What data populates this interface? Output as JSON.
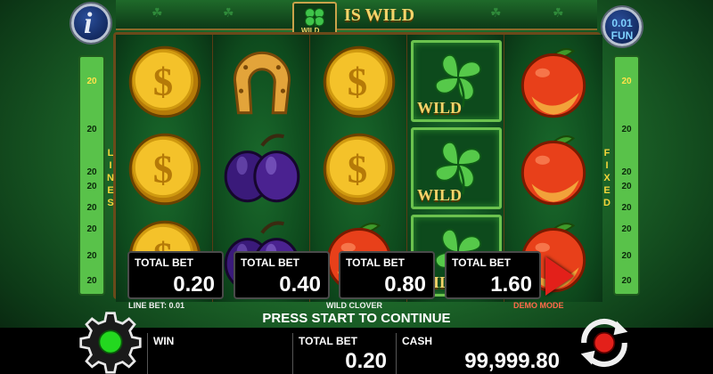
{
  "banner": {
    "wild_badge": "WILD",
    "text": "IS WILD"
  },
  "info_button": {
    "glyph": "i",
    "icon": "info-icon"
  },
  "fun_button": {
    "amount": "0.01",
    "mode": "FUN"
  },
  "side_left": {
    "word": "LINES",
    "numbers": [
      "20",
      "20",
      "20",
      "20",
      "20",
      "20",
      "20",
      "20"
    ]
  },
  "side_right": {
    "word": "FIXED",
    "numbers": [
      "20",
      "20",
      "20",
      "20",
      "20",
      "20",
      "20",
      "20"
    ]
  },
  "reels": [
    [
      "gold-coin",
      "gold-coin",
      "gold-coin"
    ],
    [
      "horseshoe",
      "plum",
      "plum"
    ],
    [
      "gold-coin",
      "gold-coin",
      "peach"
    ],
    [
      "wild-clover",
      "wild-clover",
      "wild-clover"
    ],
    [
      "peach",
      "peach",
      "peach"
    ]
  ],
  "wild_label": "WILD",
  "bet_options": [
    {
      "label": "TOTAL BET",
      "value": "0.20"
    },
    {
      "label": "TOTAL BET",
      "value": "0.40"
    },
    {
      "label": "TOTAL BET",
      "value": "0.80"
    },
    {
      "label": "TOTAL BET",
      "value": "1.60"
    }
  ],
  "strip": {
    "line_bet": "LINE BET: 0.01",
    "game_name": "WILD CLOVER",
    "mode": "DEMO MODE"
  },
  "prompt": "PRESS START TO CONTINUE",
  "bottom": {
    "win_label": "WIN",
    "win_value": "",
    "bet_label": "TOTAL BET",
    "bet_value": "0.20",
    "cash_label": "CASH",
    "cash_value": "99,999.80"
  },
  "colors": {
    "accent_gold": "#f3d46a",
    "play_red": "#e3201a",
    "status_green": "#23d81f",
    "autoplay_red": "#e3201a"
  }
}
